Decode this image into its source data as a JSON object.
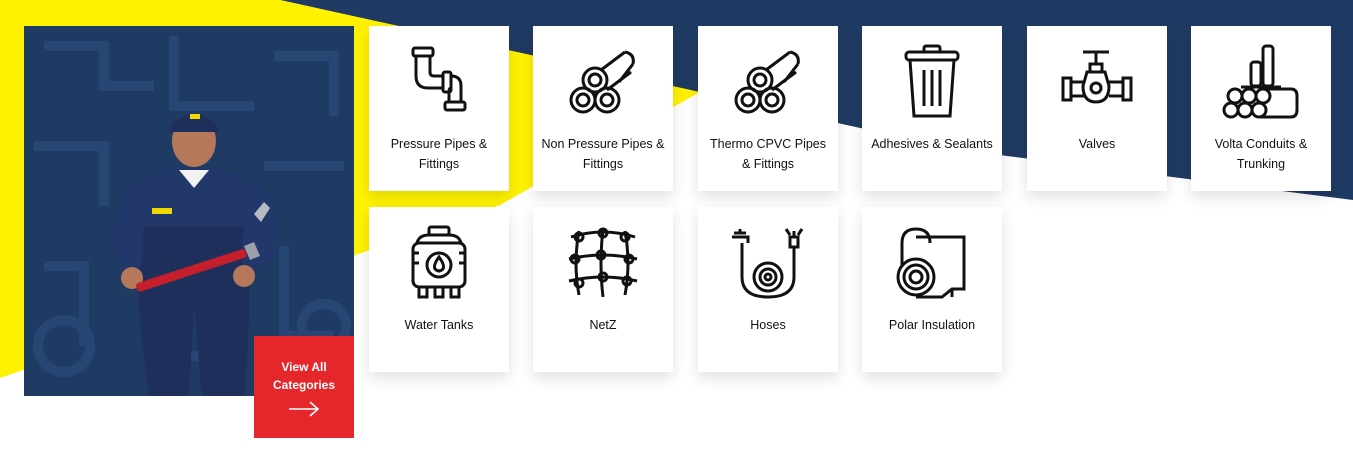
{
  "categories": [
    {
      "label": "Pressure Pipes & Fittings",
      "icon": "pressure-pipe-icon"
    },
    {
      "label": "Non Pressure Pipes & Fittings",
      "icon": "non-pressure-pipes-icon"
    },
    {
      "label": "Thermo CPVC Pipes & Fittings",
      "icon": "thermo-cpvc-pipes-icon"
    },
    {
      "label": "Adhesives & Sealants",
      "icon": "adhesive-can-icon"
    },
    {
      "label": "Valves",
      "icon": "valve-icon"
    },
    {
      "label": "Volta Conduits & Trunking",
      "icon": "conduit-pipes-icon"
    },
    {
      "label": "Water Tanks",
      "icon": "water-tank-icon"
    },
    {
      "label": "NetZ",
      "icon": "net-icon"
    },
    {
      "label": "Hoses",
      "icon": "hose-icon"
    },
    {
      "label": "Polar Insulation",
      "icon": "insulation-roll-icon"
    }
  ],
  "view_all": {
    "label": "View All Categories",
    "icon": "arrow-right-icon"
  },
  "hero": {
    "image": "plumber-with-wrench-photo"
  },
  "colors": {
    "navy": "#1f3a63",
    "yellow": "#fff200",
    "red": "#e5272b",
    "card": "#ffffff"
  }
}
